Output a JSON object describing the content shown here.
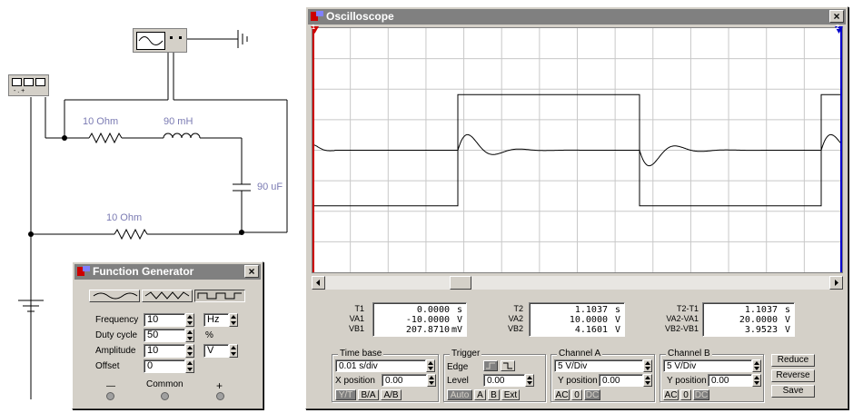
{
  "circuit": {
    "r1_label": "10  Ohm",
    "l1_label": "90 mH",
    "c1_label": "90 uF",
    "r2_label": "10  Ohm"
  },
  "function_generator": {
    "title": "Function Generator",
    "waveforms": [
      "sine",
      "triangle",
      "square"
    ],
    "selected_waveform": "square",
    "frequency": {
      "label": "Frequency",
      "value": "10",
      "unit": "Hz"
    },
    "duty_cycle": {
      "label": "Duty cycle",
      "value": "50",
      "unit": "%"
    },
    "amplitude": {
      "label": "Amplitude",
      "value": "10",
      "unit": "V"
    },
    "offset": {
      "label": "Offset",
      "value": "0"
    },
    "terminals": {
      "minus": "—",
      "common": "Common",
      "plus": "+"
    }
  },
  "oscilloscope": {
    "title": "Oscilloscope",
    "markers": {
      "left": "1",
      "right": "2"
    },
    "readouts": {
      "left": {
        "labels": [
          "T1",
          "VA1",
          "VB1"
        ],
        "values": [
          "0.0000",
          "-10.0000",
          "207.8710"
        ],
        "units": [
          "s",
          "V",
          "mV"
        ]
      },
      "mid": {
        "labels": [
          "T2",
          "VA2",
          "VB2"
        ],
        "values": [
          "1.1037",
          "10.0000",
          "4.1601"
        ],
        "units": [
          "s",
          "V",
          "V"
        ]
      },
      "right": {
        "labels": [
          "T2-T1",
          "VA2-VA1",
          "VB2-VB1"
        ],
        "values": [
          "1.1037",
          "20.0000",
          "3.9523"
        ],
        "units": [
          "s",
          "V",
          "V"
        ]
      }
    },
    "timebase": {
      "label": "Time base",
      "value": "0.01 s/div",
      "xpos_label": "X position",
      "xpos_value": "0.00",
      "modes": [
        "Y/T",
        "B/A",
        "A/B"
      ],
      "active_mode": "Y/T"
    },
    "trigger": {
      "label": "Trigger",
      "edge_label": "Edge",
      "level_label": "Level",
      "level_value": "0.00",
      "buttons": [
        "Auto",
        "A",
        "B",
        "Ext"
      ],
      "active": "Auto"
    },
    "channel_a": {
      "label": "Channel A",
      "value": "5 V/Div",
      "ypos_label": "Y position",
      "ypos_value": "0.00",
      "coupling": [
        "AC",
        "0",
        "DC"
      ],
      "active": "DC"
    },
    "channel_b": {
      "label": "Channel B",
      "value": "5 V/Div",
      "ypos_label": "Y position",
      "ypos_value": "0.00",
      "coupling": [
        "AC",
        "0",
        "DC"
      ],
      "active": "DC"
    },
    "buttons": {
      "reduce": "Reduce",
      "reverse": "Reverse",
      "save": "Save"
    },
    "trace_colors": {
      "grid": "#c8c8c8",
      "trace": "#000000",
      "cursor1": "#cc0000",
      "cursor2": "#0000cc"
    }
  }
}
